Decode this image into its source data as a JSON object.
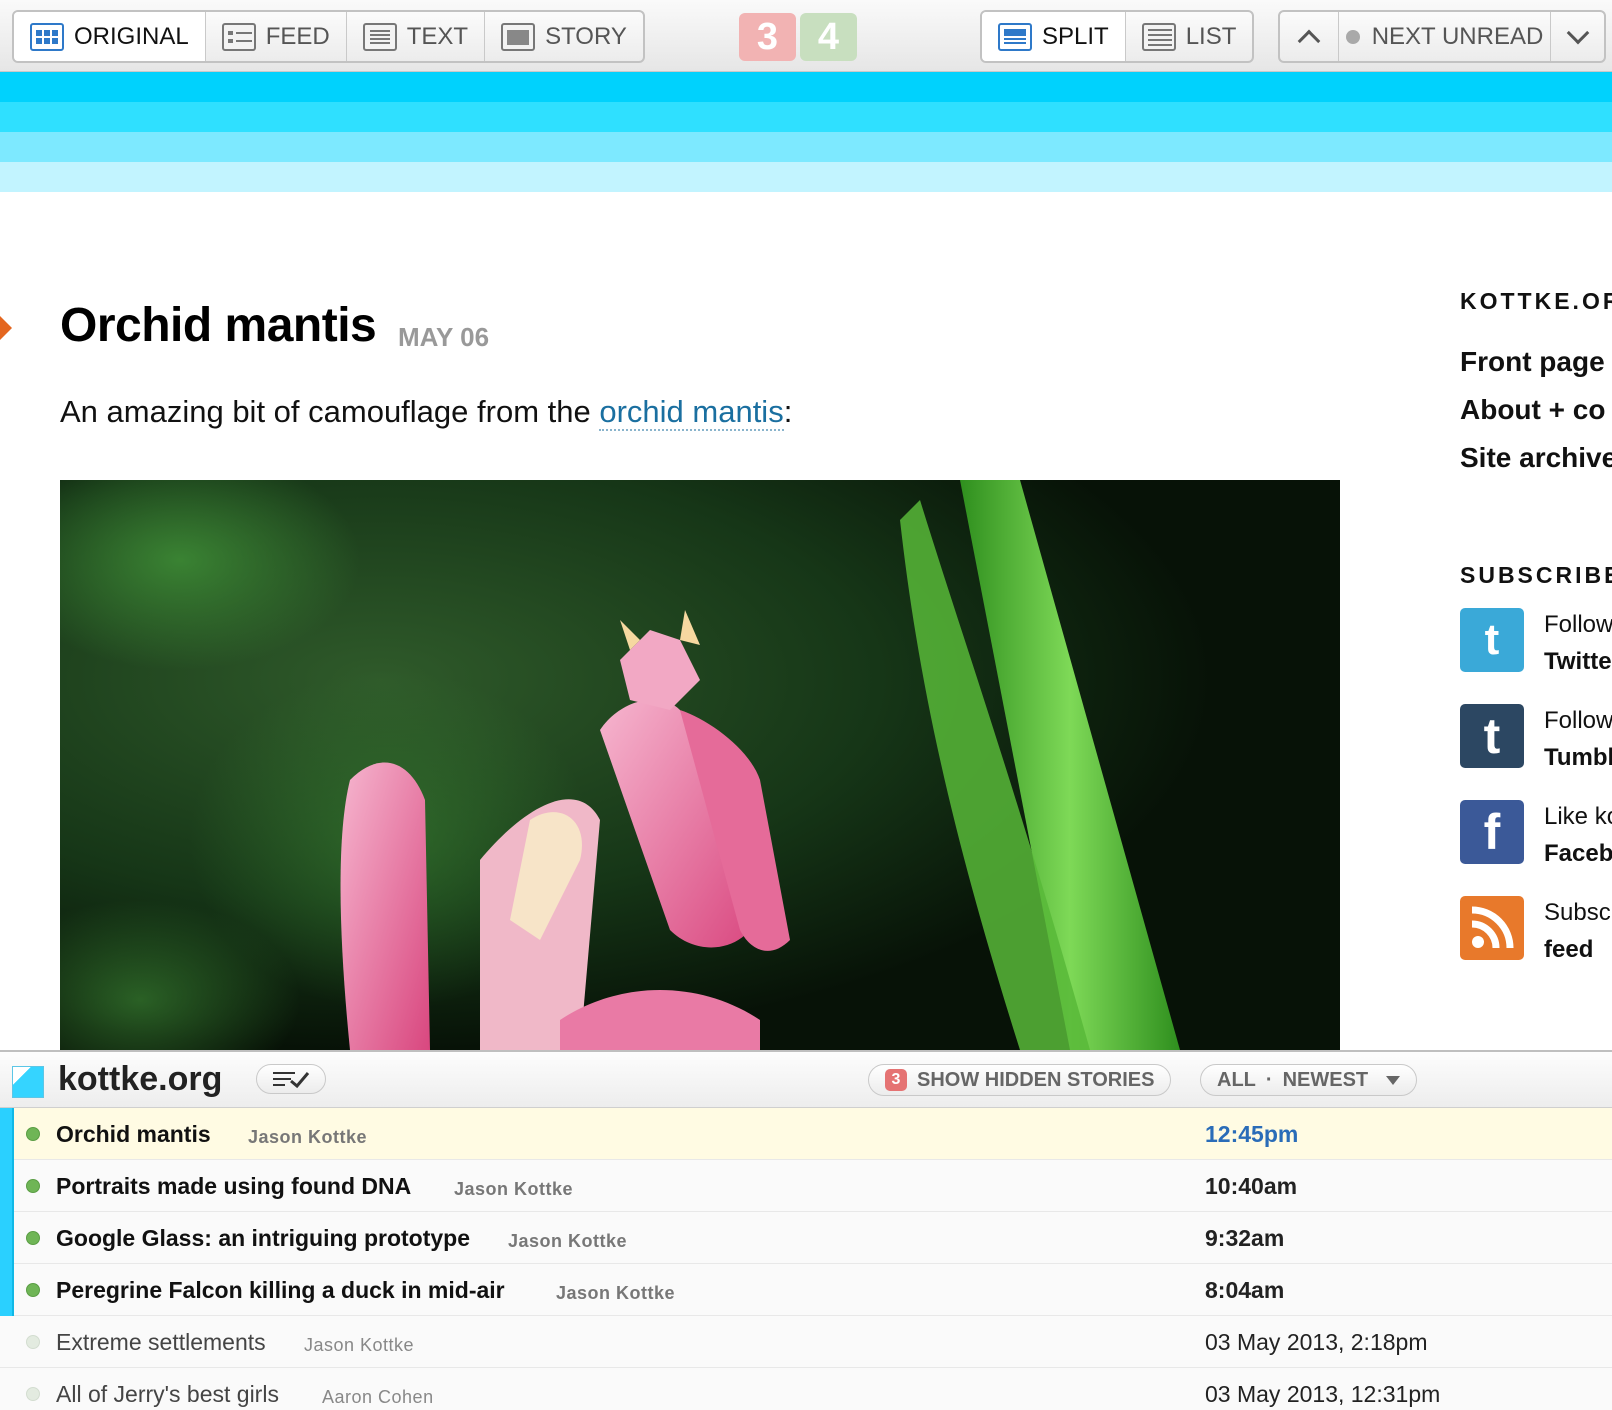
{
  "toolbar": {
    "view_modes": [
      {
        "label": "ORIGINAL",
        "icon": "original-view-icon",
        "active": true
      },
      {
        "label": "FEED",
        "icon": "feed-view-icon",
        "active": false
      },
      {
        "label": "TEXT",
        "icon": "text-view-icon",
        "active": false
      },
      {
        "label": "STORY",
        "icon": "story-view-icon",
        "active": false
      }
    ],
    "negative_count": "3",
    "positive_count": "4",
    "layout_modes": [
      {
        "label": "SPLIT",
        "icon": "split-layout-icon",
        "active": true
      },
      {
        "label": "LIST",
        "icon": "list-layout-icon",
        "active": false
      }
    ],
    "next_unread_label": "NEXT UNREAD",
    "previous_icon": "chevron-up-icon",
    "more_icon": "chevron-down-icon"
  },
  "site": {
    "stripe_colors": [
      "#00d2fd",
      "#2fe0ff",
      "#7de9ff",
      "#c2f4ff"
    ]
  },
  "article": {
    "title": "Orchid mantis",
    "date": "MAY 06",
    "intro_before": "An amazing bit of camouflage from the ",
    "intro_link": "orchid mantis",
    "intro_after": ":"
  },
  "sidebar": {
    "heading_site": "KOTTKE.OR",
    "links": [
      "Front page",
      "About + co",
      "Site archive"
    ],
    "heading_subscribe": "SUBSCRIBE",
    "social": [
      {
        "icon": "twitter-icon",
        "color": "#3aa9d8",
        "glyph": "t",
        "line1": "Follow",
        "line2": "Twitte"
      },
      {
        "icon": "tumblr-icon",
        "color": "#2c4762",
        "glyph": "t",
        "line1": "Follow",
        "line2": "Tumbl"
      },
      {
        "icon": "facebook-icon",
        "color": "#3b5998",
        "glyph": "f",
        "line1": "Like ko",
        "line2": "Faceb"
      },
      {
        "icon": "rss-icon",
        "color": "#e8792b",
        "glyph": "",
        "line1": "Subsc",
        "line2": "feed"
      }
    ]
  },
  "story_pane": {
    "feed_name": "kottke.org",
    "hidden_count": "3",
    "hidden_label": "SHOW HIDDEN STORIES",
    "filter_all": "ALL",
    "filter_sep": "·",
    "filter_order": "NEWEST",
    "stories": [
      {
        "title": "Orchid mantis",
        "author": "Jason Kottke",
        "date": "12:45pm",
        "unread": true,
        "selected": true
      },
      {
        "title": "Portraits made using found DNA",
        "author": "Jason Kottke",
        "date": "10:40am",
        "unread": true,
        "selected": false
      },
      {
        "title": "Google Glass: an intriguing prototype",
        "author": "Jason Kottke",
        "date": "9:32am",
        "unread": true,
        "selected": false
      },
      {
        "title": "Peregrine Falcon killing a duck in mid-air",
        "author": "Jason Kottke",
        "date": "8:04am",
        "unread": true,
        "selected": false
      },
      {
        "title": "Extreme settlements",
        "author": "Jason Kottke",
        "date": "03 May 2013, 2:18pm",
        "unread": false,
        "selected": false
      },
      {
        "title": "All of Jerry's best girls",
        "author": "Aaron Cohen",
        "date": "03 May 2013, 12:31pm",
        "unread": false,
        "selected": false
      }
    ]
  }
}
